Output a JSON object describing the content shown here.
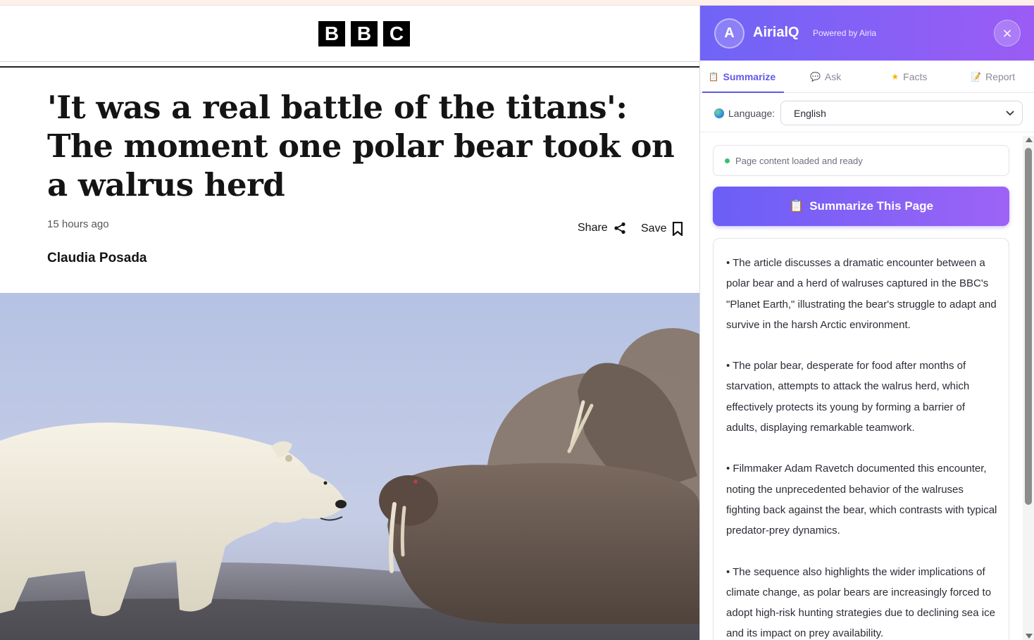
{
  "article": {
    "logo_letters": [
      "B",
      "B",
      "C"
    ],
    "headline": "'It was a real battle of the titans': The moment one polar bear took on a walrus herd",
    "timestamp": "15 hours ago",
    "author": "Claudia Posada",
    "share_label": "Share",
    "save_label": "Save"
  },
  "panel": {
    "avatar_letter": "A",
    "app_name": "AirialQ",
    "powered_by": "Powered by Airia",
    "close_label": "×",
    "tabs": [
      {
        "label": "Summarize",
        "icon": "clipboard-icon",
        "active": true
      },
      {
        "label": "Ask",
        "icon": "speech-bubble-icon",
        "active": false
      },
      {
        "label": "Facts",
        "icon": "star-icon",
        "active": false
      },
      {
        "label": "Report",
        "icon": "memo-icon",
        "active": false
      }
    ],
    "language_label": "Language:",
    "language_value": "English",
    "status_text": "Page content loaded and ready",
    "summarize_button": "Summarize This Page",
    "summary_points": [
      "• The article discusses a dramatic encounter between a polar bear and a herd of walruses captured in the BBC's \"Planet Earth,\" illustrating the bear's struggle to adapt and survive in the harsh Arctic environment.",
      "• The polar bear, desperate for food after months of starvation, attempts to attack the walrus herd, which effectively protects its young by forming a barrier of adults, displaying remarkable teamwork.",
      "• Filmmaker Adam Ravetch documented this encounter, noting the unprecedented behavior of the walruses fighting back against the bear, which contrasts with typical predator-prey dynamics.",
      "• The sequence also highlights the wider implications of climate change, as polar bears are increasingly forced to adopt high-risk hunting strategies due to declining sea ice and its impact on prey availability."
    ]
  },
  "colors": {
    "accent": "#6258e8",
    "header_gradient_start": "#6f64f6",
    "header_gradient_end": "#9b5cf5",
    "status_ok": "#38c172"
  }
}
